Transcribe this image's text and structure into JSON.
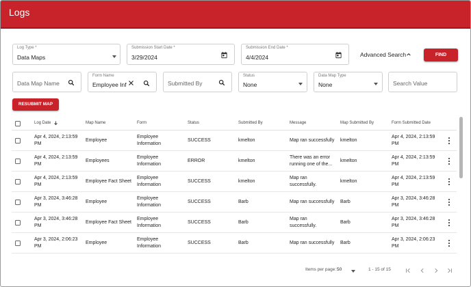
{
  "header": {
    "title": "Logs"
  },
  "filters": {
    "log_type": {
      "label": "Log Type *",
      "value": "Data Maps"
    },
    "start_date": {
      "label": "Submission Start Date *",
      "value": "3/29/2024"
    },
    "end_date": {
      "label": "Submission End Date *",
      "value": "4/4/2024"
    },
    "advanced_search": "Advanced Search",
    "find": "FIND",
    "data_map_name": {
      "placeholder": "Data Map Name"
    },
    "form_name": {
      "label": "Form Name",
      "value": "Employee Inf"
    },
    "submitted_by": {
      "placeholder": "Submitted By"
    },
    "status": {
      "label": "Status",
      "value": "None"
    },
    "data_map_type": {
      "label": "Data Map Type",
      "value": "None"
    },
    "search_value": {
      "placeholder": "Search Value"
    }
  },
  "resubmit": "RESUBMIT MAP",
  "table": {
    "columns": {
      "log_date": "Log Date",
      "map_name": "Map Name",
      "form": "Form",
      "status": "Status",
      "submitted_by": "Submitted By",
      "message": "Message",
      "map_submitted_by": "Map Submitted By",
      "form_submitted_date": "Form Submitted Date"
    },
    "rows": [
      {
        "log_date": "Apr 4, 2024, 2:13:59 PM",
        "map_name": "Employee",
        "form": "Employee Information",
        "status": "SUCCESS",
        "submitted_by": "kmelton",
        "message": "Map ran successfully",
        "map_submitted_by": "kmelton",
        "form_submitted_date": "Apr 4, 2024, 2:13:59 PM"
      },
      {
        "log_date": "Apr 4, 2024, 2:13:59 PM",
        "map_name": "Employees",
        "form": "Employee Information",
        "status": "ERROR",
        "submitted_by": "kmelton",
        "message": "There was an error running one of the...",
        "map_submitted_by": "kmelton",
        "form_submitted_date": "Apr 4, 2024, 2:13:59 PM"
      },
      {
        "log_date": "Apr 4, 2024, 2:13:59 PM",
        "map_name": "Employee Fact Sheet",
        "form": "Employee Information",
        "status": "SUCCESS",
        "submitted_by": "kmelton",
        "message": "Map ran successfully.",
        "map_submitted_by": "kmelton",
        "form_submitted_date": "Apr 4, 2024, 2:13:59 PM"
      },
      {
        "log_date": "Apr 3, 2024, 3:46:28 PM",
        "map_name": "Employee",
        "form": "Employee Information",
        "status": "SUCCESS",
        "submitted_by": "Barb",
        "message": "Map ran successfully",
        "map_submitted_by": "Barb",
        "form_submitted_date": "Apr 3, 2024, 3:46:28 PM"
      },
      {
        "log_date": "Apr 3, 2024, 3:46:28 PM",
        "map_name": "Employee Fact Sheet",
        "form": "Employee Information",
        "status": "SUCCESS",
        "submitted_by": "Barb",
        "message": "Map ran successfully.",
        "map_submitted_by": "Barb",
        "form_submitted_date": "Apr 3, 2024, 3:46:28 PM"
      },
      {
        "log_date": "Apr 3, 2024, 2:06:23 PM",
        "map_name": "Employee",
        "form": "Employee Information",
        "status": "SUCCESS",
        "submitted_by": "Barb",
        "message": "Map ran successfully",
        "map_submitted_by": "Barb",
        "form_submitted_date": "Apr 3, 2024, 2:06:23 PM"
      }
    ]
  },
  "pagination": {
    "items_per_page_label": "Items per page:",
    "items_per_page": "50",
    "range": "1 - 15 of 15"
  },
  "colors": {
    "brand": "#c8222b"
  },
  "icons": [
    "chevron-down-icon",
    "calendar-icon",
    "search-icon",
    "close-icon",
    "chevron-up-icon",
    "arrow-down-icon",
    "more-vert-icon",
    "first-page-icon",
    "prev-page-icon",
    "next-page-icon",
    "last-page-icon"
  ]
}
